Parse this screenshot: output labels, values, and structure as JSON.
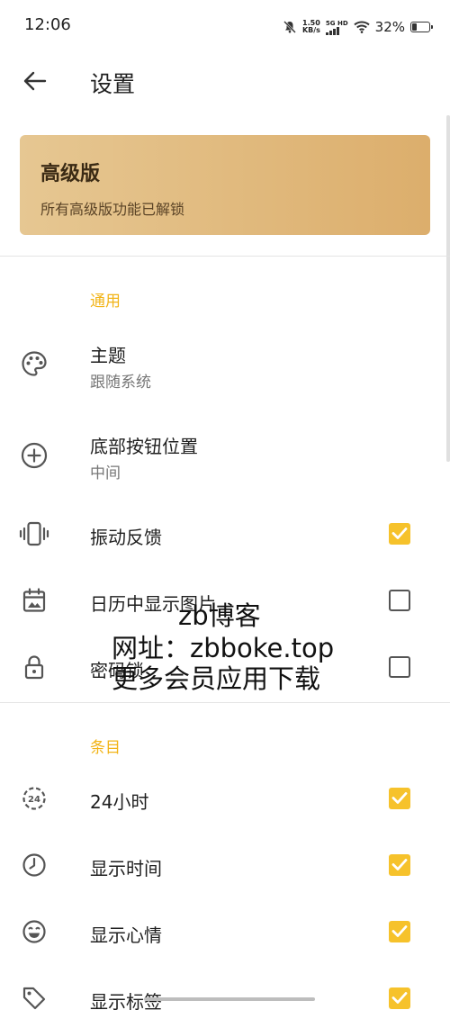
{
  "status_bar": {
    "time": "12:06",
    "net_speed_value": "1.50",
    "net_speed_unit": "KB/s",
    "signal_label": "5G HD",
    "battery_percent": "32%",
    "battery_level": 0.32
  },
  "app_bar": {
    "title": "设置"
  },
  "premium": {
    "title": "高级版",
    "subtitle": "所有高级版功能已解锁"
  },
  "sections": {
    "general": {
      "header": "通用",
      "theme": {
        "label": "主题",
        "value": "跟随系统"
      },
      "bottom_button": {
        "label": "底部按钮位置",
        "value": "中间"
      },
      "vibration": {
        "label": "振动反馈",
        "checked": true
      },
      "calendar_images": {
        "label": "日历中显示图片",
        "checked": false
      },
      "password_lock": {
        "label": "密码锁",
        "checked": false
      }
    },
    "entries": {
      "header": "条目",
      "hour24": {
        "label": "24小时",
        "checked": true
      },
      "show_time": {
        "label": "显示时间",
        "checked": true
      },
      "show_mood": {
        "label": "显示心情",
        "checked": true
      },
      "show_tags": {
        "label": "显示标签",
        "checked": true
      }
    }
  },
  "watermark": {
    "line1": "zb博客",
    "line2": "网址：zbboke.top",
    "line3": "更多会员应用下载"
  },
  "colors": {
    "accent": "#f2b417",
    "checkbox_on": "#f6c22b",
    "premium_start": "#e6c792",
    "premium_end": "#dcae6c"
  }
}
